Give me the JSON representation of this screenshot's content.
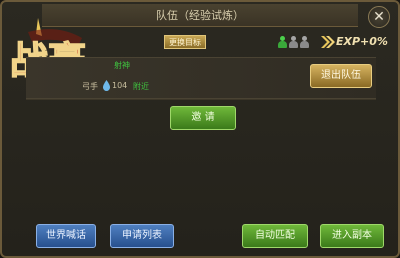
{
  "header": {
    "title": "队伍（经验试炼）",
    "close_glyph": "✕"
  },
  "logo": {
    "text": "战豪"
  },
  "toolbar": {
    "change_target_label": "更换目标",
    "exp_label": "EXP+0%",
    "member_icons": [
      {
        "color": "#4bd04b",
        "state": "active"
      },
      {
        "color": "#9a9a9a",
        "state": "empty"
      },
      {
        "color": "#9a9a9a",
        "state": "empty"
      }
    ]
  },
  "member": {
    "title": "射神",
    "class": "弓手",
    "level": "104",
    "location": "附近",
    "leave_label": "退出队伍"
  },
  "invite_label": "邀 请",
  "bottom": {
    "world_chat": "世界喊话",
    "request_list": "申请列表",
    "auto_match": "自动匹配",
    "enter_dungeon": "进入副本"
  },
  "colors": {
    "frame_border": "#6b5a3a",
    "gold_button": "#c9a855",
    "green_button": "#5aa02e",
    "blue_button": "#3a66a8",
    "green_text": "#3fc23f"
  }
}
